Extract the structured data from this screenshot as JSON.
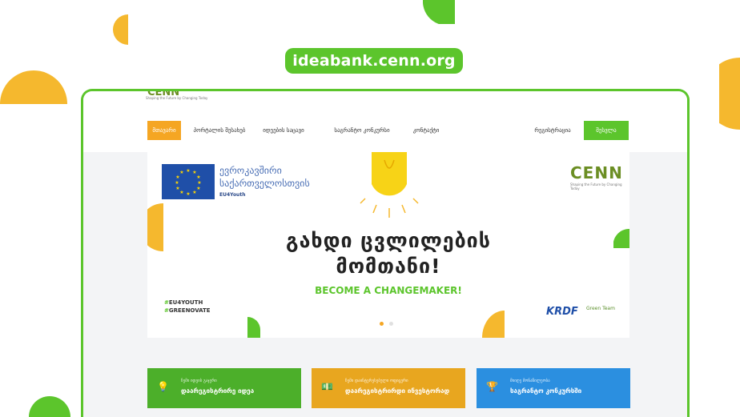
{
  "url": "ideabank.cenn.org",
  "site_logo": {
    "name": "CENN",
    "tagline": "Shaping the Future by Changing Today"
  },
  "nav": {
    "items": [
      {
        "label": "მთავარი",
        "active": true
      },
      {
        "label": "პორტალის შესახებ",
        "active": false
      },
      {
        "label": "იდეების საცავი",
        "active": false
      },
      {
        "label": "საგრანტო კონკურსი",
        "active": false
      },
      {
        "label": "კონტაქტი",
        "active": false
      }
    ],
    "register_label": "რეგისტრაცია",
    "login_label": "შესვლა"
  },
  "hero": {
    "eu_line1": "ევროკავშირი",
    "eu_line2": "საქართველოსთვის",
    "eu_line3": "EU4Youth",
    "headline_line1": "გახდი ცვლილების",
    "headline_line2": "მომთანი!",
    "tagline": "BECOME A CHANGEMAKER!",
    "hashtags": [
      {
        "hash": "#",
        "text": "EU4YOUTH"
      },
      {
        "hash": "#",
        "text": "GREENOVATE"
      }
    ],
    "partner1": "KRDF",
    "partner2": "Green Team"
  },
  "cards": [
    {
      "small": "ჩემი იდეის გაჯერი",
      "big": "დაარეგისტრირე იდეა",
      "color": "#4caf2a",
      "icon": "lightbulb-icon"
    },
    {
      "small": "ჩემი დაინტერესებული ოფიცერი",
      "big": "დაარეგისტრირდი ინვესტორად",
      "color": "#e8a61f",
      "icon": "money-icon"
    },
    {
      "small": "მიიღე მონაწილეობა",
      "big": "საგრანტო კონკურსში",
      "color": "#2b8fe0",
      "icon": "trophy-icon"
    }
  ],
  "colors": {
    "brand_green": "#5cc52c",
    "accent_orange": "#f5a623",
    "eu_blue": "#1f4fa8"
  }
}
